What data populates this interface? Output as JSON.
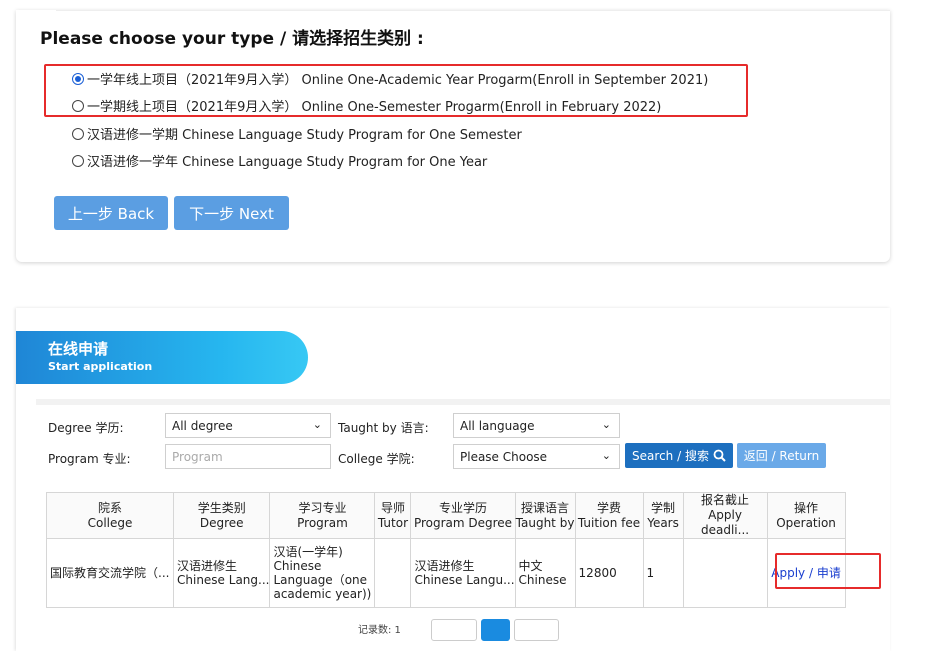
{
  "choose": {
    "title": "Please choose your type / 请选择招生类别 :",
    "options": [
      {
        "label": "一学年线上项目（2021年9月入学） Online One-Academic Year Progarm(Enroll in September 2021)",
        "selected": true
      },
      {
        "label": "一学期线上项目（2021年9月入学） Online One-Semester Progarm(Enroll in February 2022)",
        "selected": false
      },
      {
        "label": "汉语进修一学期 Chinese Language Study Program for One Semester",
        "selected": false
      },
      {
        "label": "汉语进修一学年 Chinese Language Study Program for One Year",
        "selected": false
      }
    ],
    "back_label": "上一步 Back",
    "next_label": "下一步 Next"
  },
  "application": {
    "title": "在线申请",
    "subtitle": "Start application"
  },
  "filters": {
    "degree_label": "Degree 学历:",
    "degree_value": "All degree",
    "taught_label": "Taught by 语言:",
    "taught_value": "All language",
    "program_label": "Program 专业:",
    "program_placeholder": "Program",
    "college_label": "College 学院:",
    "college_value": "Please Choose",
    "search_label": "Search / 搜索",
    "return_label": "返回 / Return"
  },
  "table": {
    "headers": [
      {
        "cn": "院系",
        "en": "College"
      },
      {
        "cn": "学生类别",
        "en": "Degree"
      },
      {
        "cn": "学习专业",
        "en": "Program"
      },
      {
        "cn": "导师",
        "en": "Tutor"
      },
      {
        "cn": "专业学历",
        "en": "Program Degree"
      },
      {
        "cn": "授课语言",
        "en": "Taught by"
      },
      {
        "cn": "学费",
        "en": "Tuition fee"
      },
      {
        "cn": "学制",
        "en": "Years"
      },
      {
        "cn": "报名截止",
        "en": "Apply deadli..."
      },
      {
        "cn": "操作",
        "en": "Operation"
      }
    ],
    "row": {
      "college": "国际教育交流学院（...",
      "degree_cn": "汉语进修生",
      "degree_en": "Chinese Lang...",
      "program_1": "汉语(一学年)",
      "program_2": "Chinese",
      "program_3": "Language（one",
      "program_4": "academic year))",
      "tutor": "",
      "pdegree_cn": "汉语进修生",
      "pdegree_en": "Chinese Langu...",
      "taught_cn": "中文",
      "taught_en": "Chinese",
      "fee": "12800",
      "years": "1",
      "deadline": "",
      "operation": "Apply / 申请"
    }
  },
  "pager": {
    "text": "记录数: 1",
    "current_page": 1
  },
  "icons": {
    "search": "search-icon",
    "chevron": "chevron-down-icon"
  },
  "colors": {
    "highlight_box": "#e62b2b",
    "primary_button": "#5b9ee2",
    "search_button": "#1d6fbf",
    "return_button": "#6aa9e8",
    "link": "#1a3ecf"
  }
}
